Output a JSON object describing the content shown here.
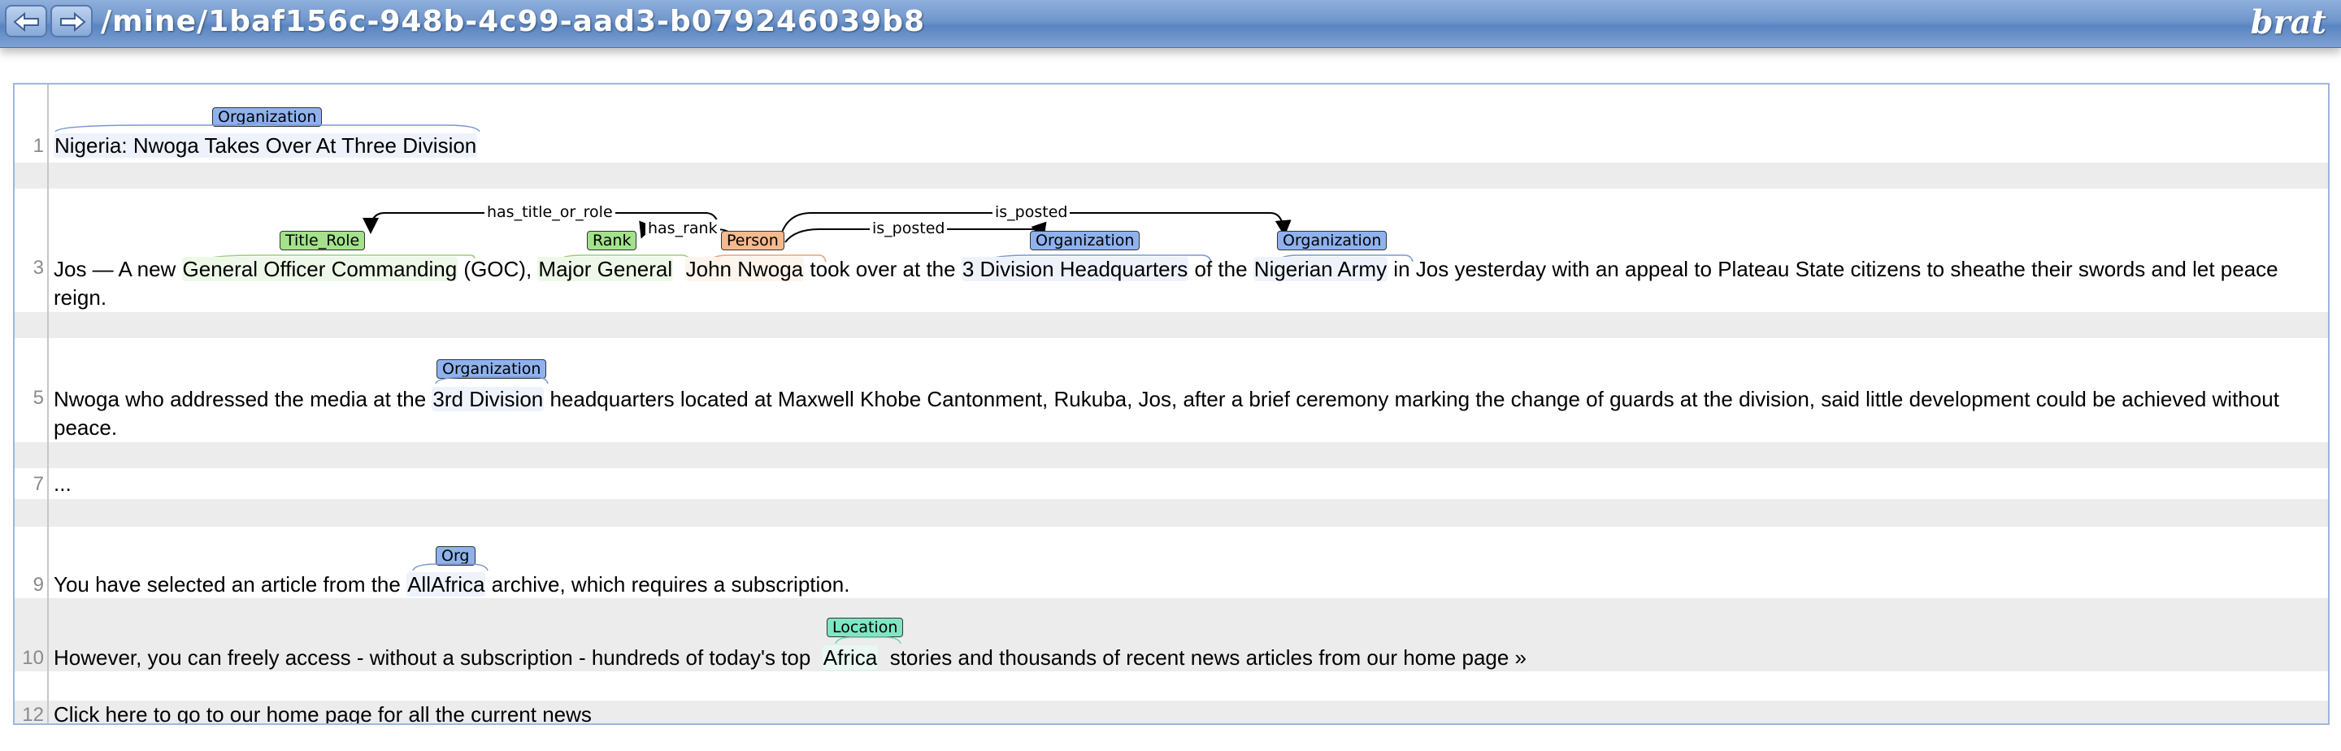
{
  "header": {
    "path": "/mine/1baf156c-948b-4c99-aad3-b079246039b8",
    "logo": "brat"
  },
  "colors": {
    "organization": "#8fb2ee",
    "title_role": "#a4e18c",
    "person": "#f6b98e",
    "location": "#7ee6c4"
  },
  "line1": {
    "num": "1",
    "text": "Nigeria: Nwoga Takes Over At Three Division",
    "label_org": "Organization"
  },
  "line3": {
    "num": "3",
    "pre": "Jos — A new ",
    "title_role_span": "General Officer Commanding",
    "mid1": " (GOC), ",
    "rank_span": "Major General",
    "mid2": "  ",
    "person_span": "John Nwoga",
    "mid3": " took over at the ",
    "org1_span": "3 Division Headquarters",
    "mid4": " of the ",
    "org2_span": "Nigerian Army",
    "post": " in Jos yesterday with an appeal to Plateau State citizens to sheathe their swords and let peace reign.",
    "labels": {
      "title_role": "Title_Role",
      "rank": "Rank",
      "person": "Person",
      "org1": "Organization",
      "org2": "Organization"
    },
    "arcs": {
      "has_title_or_role": "has_title_or_role",
      "has_rank": "has_rank",
      "is_posted_1": "is_posted",
      "is_posted_2": "is_posted"
    }
  },
  "line5": {
    "num": "5",
    "pre": "Nwoga who addressed the media at the ",
    "org_span": "3rd Division",
    "post": " headquarters located at Maxwell Khobe Cantonment, Rukuba, Jos, after a brief ceremony marking the change of guards at the division, said little development could be achieved without peace.",
    "label_org": "Organization"
  },
  "line7": {
    "num": "7",
    "text": "..."
  },
  "line9": {
    "num": "9",
    "pre": "You have selected an article from the ",
    "org_span": "AllAfrica",
    "post": " archive, which requires a subscription.",
    "label_org": "Org"
  },
  "line10": {
    "num": "10",
    "pre": "However, you can freely access - without a subscription - hundreds of today's top  ",
    "loc_span": "Africa",
    "post": "  stories and thousands of recent news articles from our home page »",
    "label_loc": "Location"
  },
  "line12": {
    "num": "12",
    "text": "Click here to go to our home page for all the current news"
  }
}
